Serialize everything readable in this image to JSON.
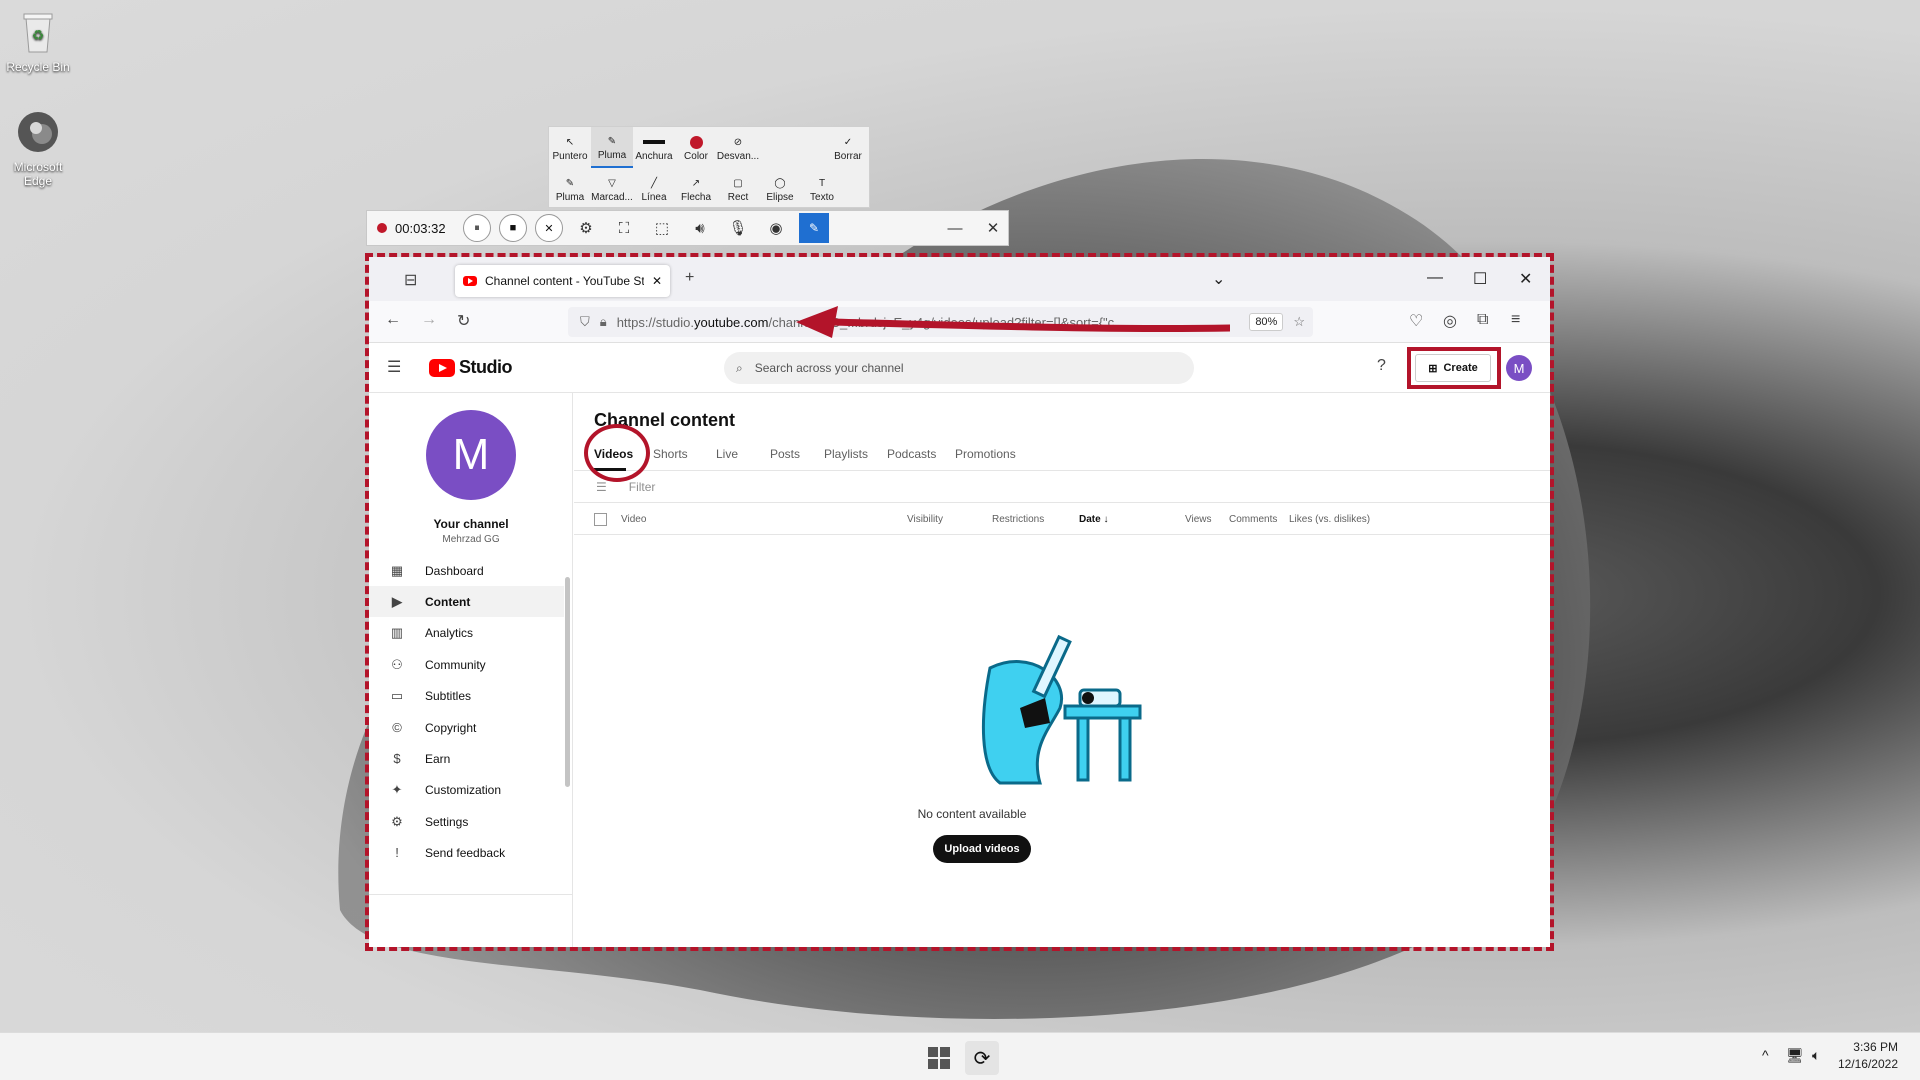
{
  "desktop": {
    "icons": [
      {
        "label": "Recycle Bin"
      },
      {
        "label": "Microsoft Edge"
      }
    ]
  },
  "annotation_toolbar": {
    "row1": [
      "Puntero",
      "Pluma",
      "Anchura",
      "Color",
      "Desvan...",
      "Borrar"
    ],
    "row2": [
      "Pluma",
      "Marcad...",
      "Línea",
      "Flecha",
      "Rect",
      "Elipse",
      "Texto"
    ],
    "accent": "#1f6fd1",
    "pen_color": "#c0182a"
  },
  "recorder": {
    "time": "00:03:32"
  },
  "browser": {
    "tab_title": "Channel content - YouTube Stu",
    "url_prefix": "https://studio.",
    "url_host": "youtube.com",
    "url_rest": "/channel/UC_...brdsjnE_y4g/videos/upload?filter=[]&sort={\"c",
    "zoom": "80%"
  },
  "studio": {
    "logo_text": "Studio",
    "search_placeholder": "Search across your channel",
    "create_label": "Create",
    "avatar_letter": "M",
    "channel": {
      "letter": "M",
      "name": "Your channel",
      "handle": "Mehrzad GG"
    },
    "sidebar": [
      {
        "label": "Dashboard",
        "icon": "dashboard-icon"
      },
      {
        "label": "Content",
        "icon": "content-icon"
      },
      {
        "label": "Analytics",
        "icon": "analytics-icon"
      },
      {
        "label": "Community",
        "icon": "community-icon"
      },
      {
        "label": "Subtitles",
        "icon": "subtitles-icon"
      },
      {
        "label": "Copyright",
        "icon": "copyright-icon"
      },
      {
        "label": "Earn",
        "icon": "dollar-icon"
      },
      {
        "label": "Customization",
        "icon": "magic-wand-icon"
      },
      {
        "label": "Settings",
        "icon": "gear-icon"
      },
      {
        "label": "Send feedback",
        "icon": "feedback-icon"
      }
    ],
    "page_title": "Channel content",
    "tabs": [
      "Videos",
      "Shorts",
      "Live",
      "Posts",
      "Playlists",
      "Podcasts",
      "Promotions"
    ],
    "filter_placeholder": "Filter",
    "columns": [
      "Video",
      "Visibility",
      "Restrictions",
      "Date",
      "Views",
      "Comments",
      "Likes (vs. dislikes)"
    ],
    "empty_text": "No content available",
    "upload_label": "Upload videos",
    "annotation_color": "#b3142a"
  },
  "taskbar": {
    "time": "3:36 PM",
    "date": "12/16/2022"
  }
}
